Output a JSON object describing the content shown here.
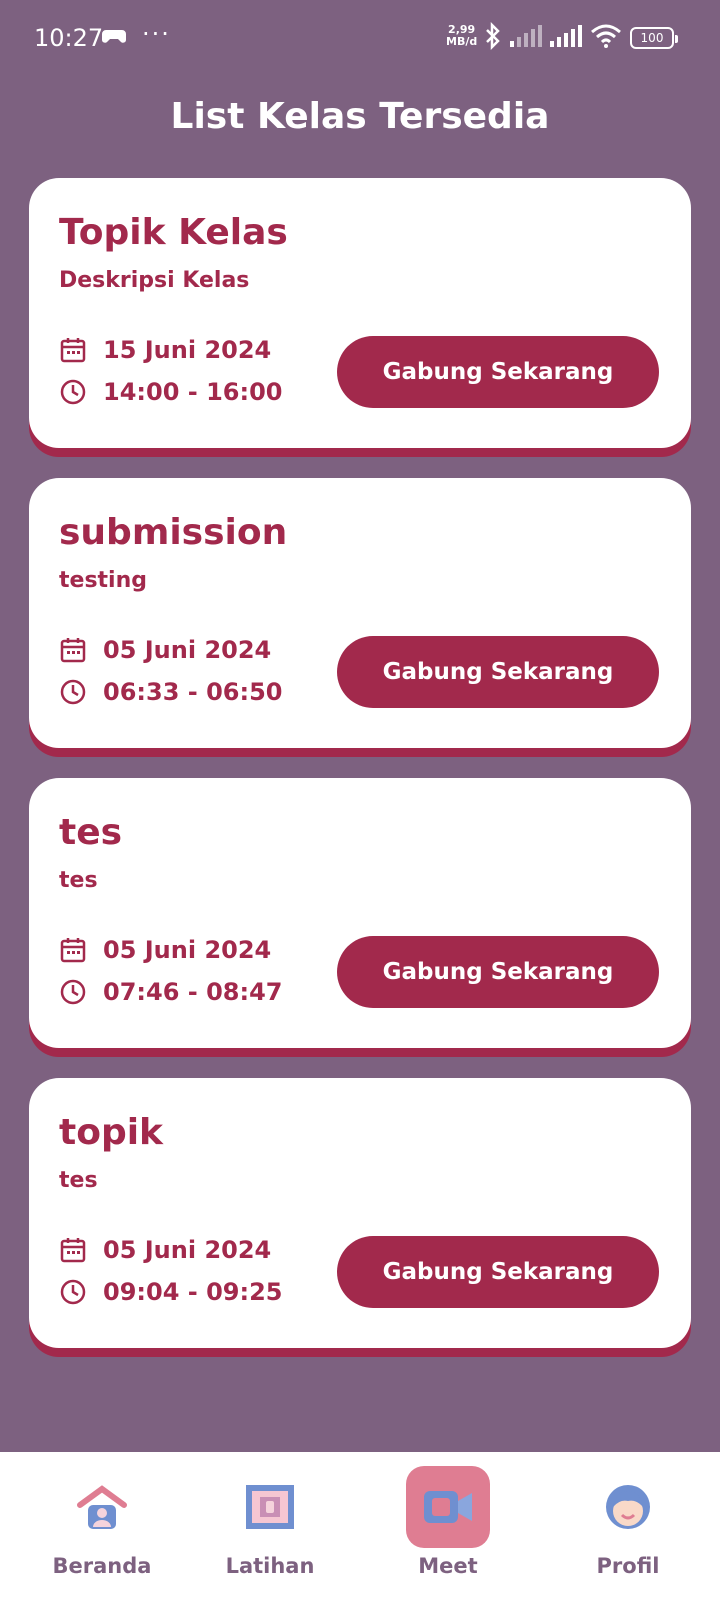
{
  "status_bar": {
    "time": "10:27",
    "dots": "···",
    "net_speed_value": "2,99",
    "net_speed_unit": "MB/d",
    "battery": "100"
  },
  "page_title": "List Kelas Tersedia",
  "classes": [
    {
      "title": "Topik Kelas",
      "description": "Deskripsi Kelas",
      "date": "15 Juni 2024",
      "time": "14:00 - 16:00",
      "button_label": "Gabung Sekarang"
    },
    {
      "title": "submission",
      "description": "testing",
      "date": "05 Juni 2024",
      "time": "06:33 - 06:50",
      "button_label": "Gabung Sekarang"
    },
    {
      "title": "tes",
      "description": "tes",
      "date": "05 Juni 2024",
      "time": "07:46 - 08:47",
      "button_label": "Gabung Sekarang"
    },
    {
      "title": "topik",
      "description": "tes",
      "date": "05 Juni 2024",
      "time": "09:04 - 09:25",
      "button_label": "Gabung Sekarang"
    }
  ],
  "bottom_nav": [
    {
      "label": "Beranda",
      "icon": "home-icon",
      "active": false
    },
    {
      "label": "Latihan",
      "icon": "exercise-icon",
      "active": false
    },
    {
      "label": "Meet",
      "icon": "video-call-icon",
      "active": true
    },
    {
      "label": "Profil",
      "icon": "profile-avatar-icon",
      "active": false
    }
  ],
  "colors": {
    "background": "#7d6180",
    "accent": "#a2294c",
    "card": "#ffffff",
    "nav_active": "#df7d92"
  }
}
